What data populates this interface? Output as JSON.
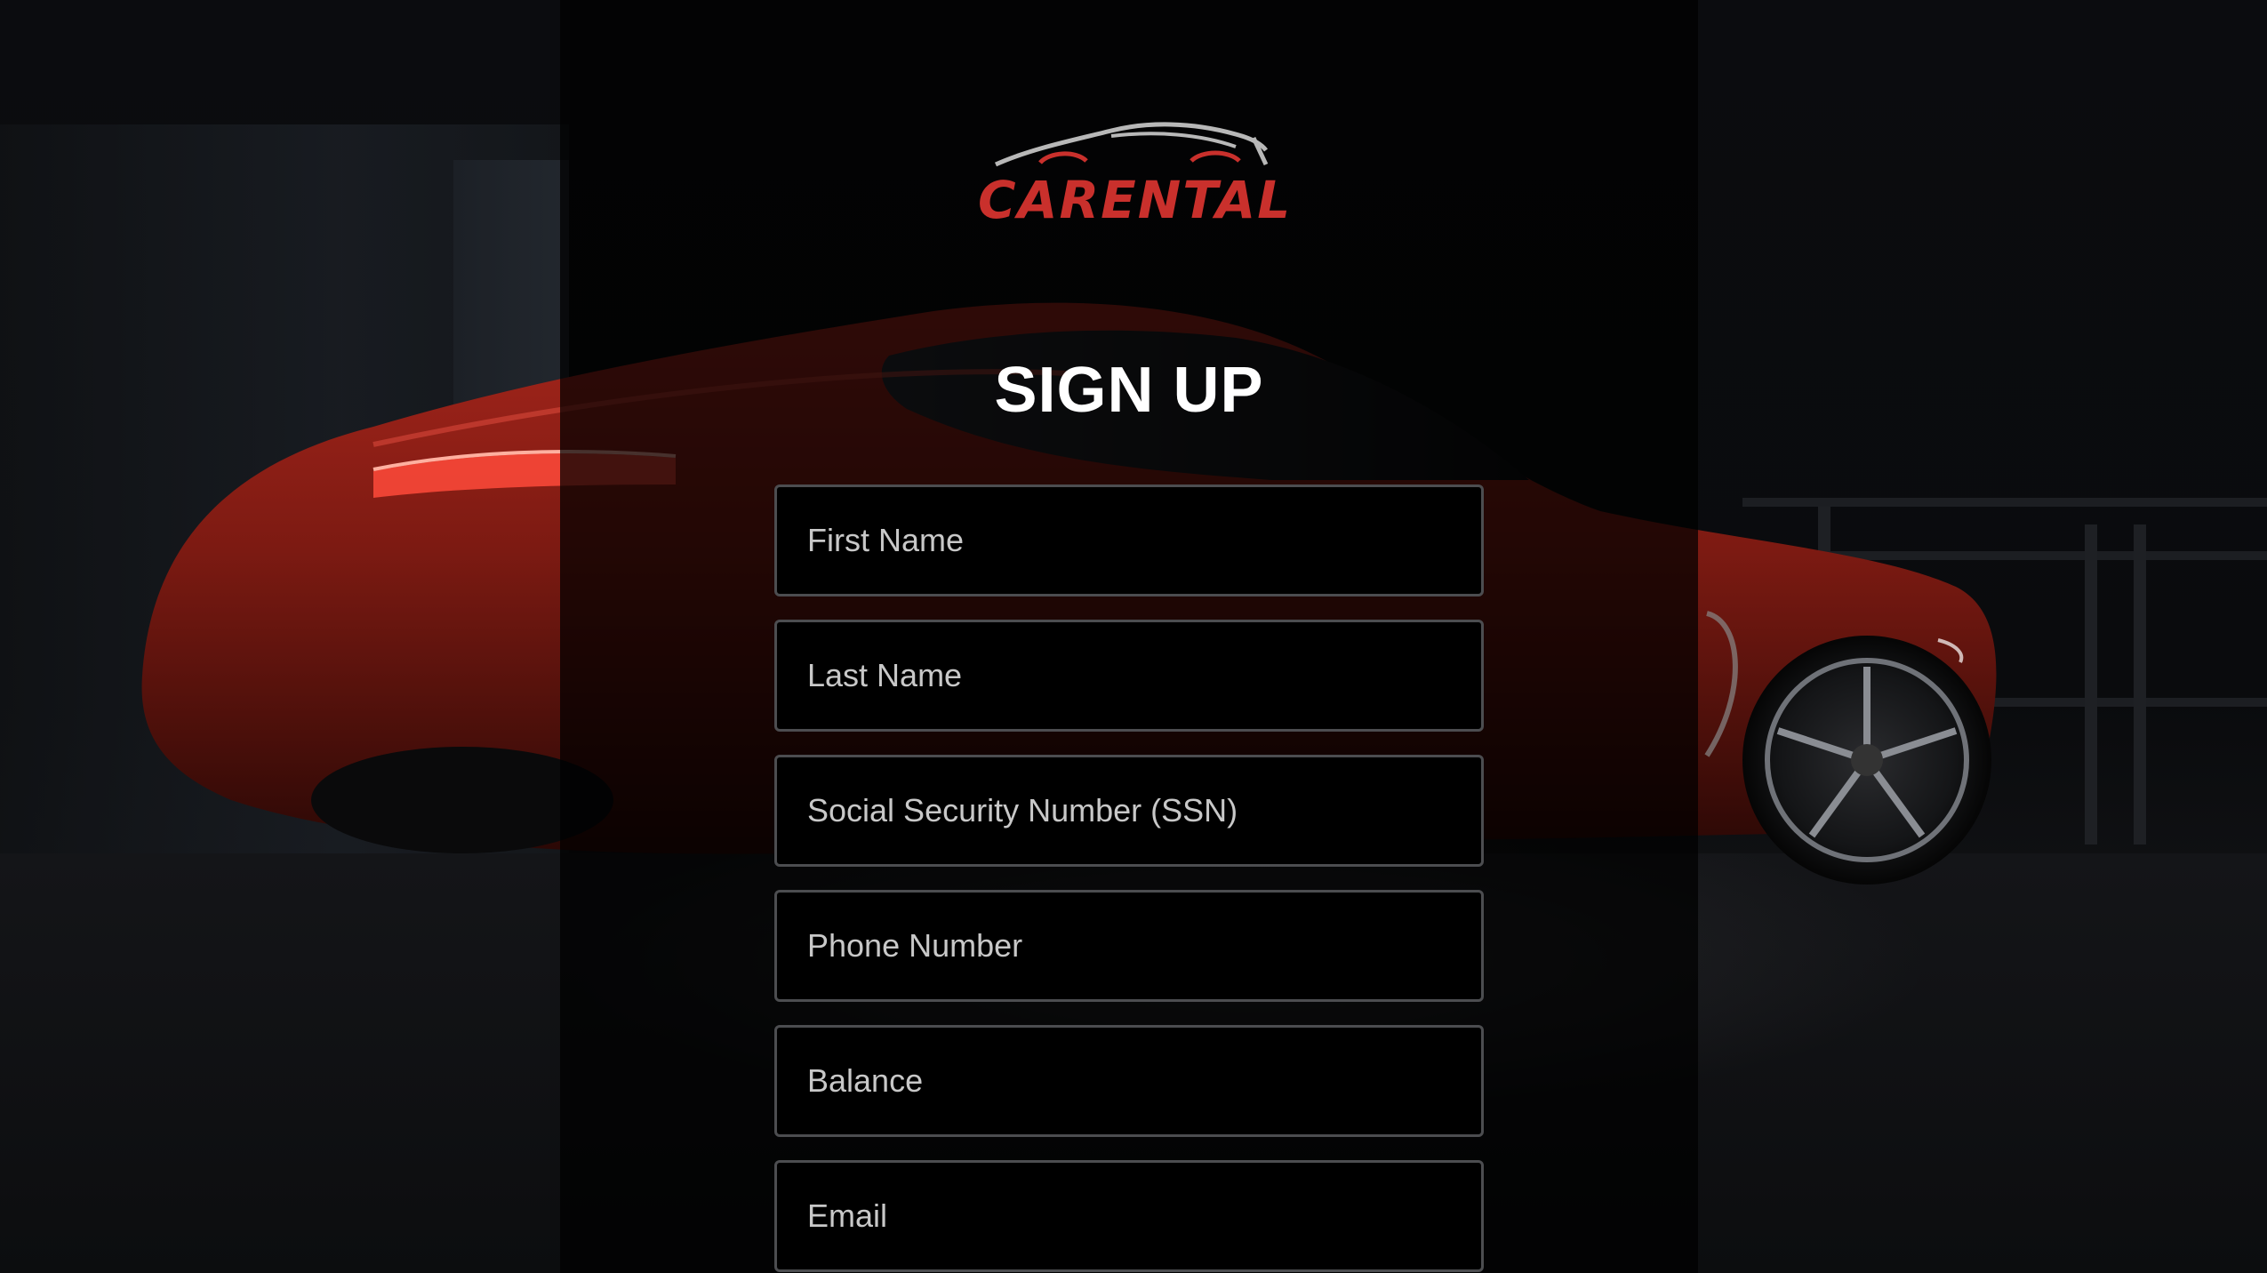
{
  "brand": {
    "name": "CARENTAL",
    "accent_color": "#c9302c",
    "logo_icon": "car-silhouette-icon"
  },
  "page": {
    "title": "SIGN UP"
  },
  "form": {
    "fields": [
      {
        "placeholder": "First Name",
        "value": ""
      },
      {
        "placeholder": "Last Name",
        "value": ""
      },
      {
        "placeholder": "Social Security Number (SSN)",
        "value": ""
      },
      {
        "placeholder": "Phone Number",
        "value": ""
      },
      {
        "placeholder": "Balance",
        "value": ""
      },
      {
        "placeholder": "Email",
        "value": ""
      }
    ]
  },
  "background": {
    "image": "red-sports-car-in-dark-garage",
    "overlay_color": "#000000"
  }
}
